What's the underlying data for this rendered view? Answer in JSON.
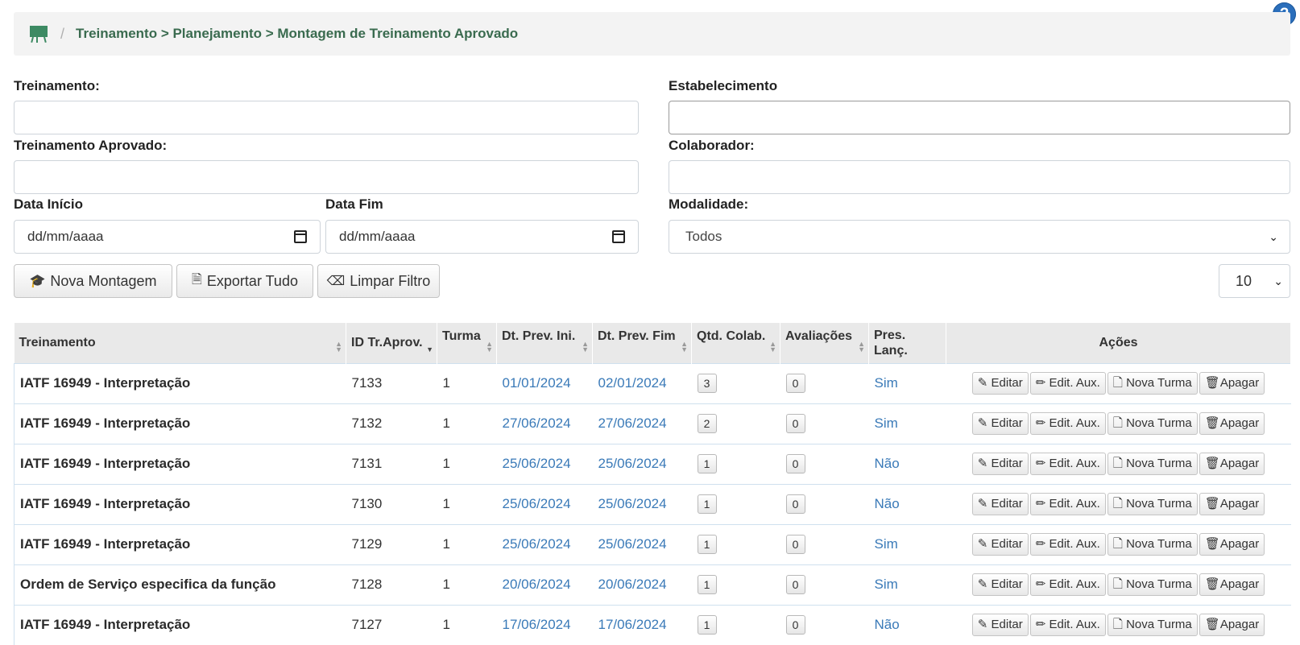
{
  "help": {
    "label": "?"
  },
  "breadcrumb": {
    "separator": "/",
    "path": "Treinamento > Planejamento > Montagem de Treinamento Aprovado"
  },
  "filters": {
    "treinamento": {
      "label": "Treinamento:",
      "value": ""
    },
    "estabelecimento": {
      "label": "Estabelecimento",
      "value": ""
    },
    "treinamento_aprovado": {
      "label": "Treinamento Aprovado:",
      "value": ""
    },
    "colaborador": {
      "label": "Colaborador:",
      "value": ""
    },
    "data_inicio": {
      "label": "Data Início",
      "placeholder": "dd/mm/aaaa"
    },
    "data_fim": {
      "label": "Data Fim",
      "placeholder": "dd/mm/aaaa"
    },
    "modalidade": {
      "label": "Modalidade:",
      "selected": "Todos"
    }
  },
  "toolbar": {
    "nova_montagem": "Nova Montagem",
    "exportar_tudo": "Exportar Tudo",
    "limpar_filtro": "Limpar Filtro",
    "page_size": "10"
  },
  "table": {
    "headers": {
      "treinamento": "Treinamento",
      "id": "ID Tr.Aprov.",
      "turma": "Turma",
      "dt_ini": "Dt. Prev. Ini.",
      "dt_fim": "Dt. Prev. Fim",
      "qtd": "Qtd. Colab.",
      "aval": "Avaliações",
      "pres_1": "Pres.",
      "pres_2": "Lanç.",
      "acoes": "Ações"
    },
    "action_labels": {
      "editar": "Editar",
      "edit_aux": "Edit. Aux.",
      "nova_turma": "Nova Turma",
      "apagar": "Apagar"
    },
    "rows": [
      {
        "treinamento": "IATF 16949 - Interpretação",
        "id": "7133",
        "turma": "1",
        "dt_ini": "01/01/2024",
        "dt_fim": "02/01/2024",
        "qtd": "3",
        "aval": "0",
        "pres": "Sim"
      },
      {
        "treinamento": "IATF 16949 - Interpretação",
        "id": "7132",
        "turma": "1",
        "dt_ini": "27/06/2024",
        "dt_fim": "27/06/2024",
        "qtd": "2",
        "aval": "0",
        "pres": "Sim"
      },
      {
        "treinamento": "IATF 16949 - Interpretação",
        "id": "7131",
        "turma": "1",
        "dt_ini": "25/06/2024",
        "dt_fim": "25/06/2024",
        "qtd": "1",
        "aval": "0",
        "pres": "Não"
      },
      {
        "treinamento": "IATF 16949 - Interpretação",
        "id": "7130",
        "turma": "1",
        "dt_ini": "25/06/2024",
        "dt_fim": "25/06/2024",
        "qtd": "1",
        "aval": "0",
        "pres": "Não"
      },
      {
        "treinamento": "IATF 16949 - Interpretação",
        "id": "7129",
        "turma": "1",
        "dt_ini": "25/06/2024",
        "dt_fim": "25/06/2024",
        "qtd": "1",
        "aval": "0",
        "pres": "Sim"
      },
      {
        "treinamento": "Ordem de Serviço especifica da função",
        "id": "7128",
        "turma": "1",
        "dt_ini": "20/06/2024",
        "dt_fim": "20/06/2024",
        "qtd": "1",
        "aval": "0",
        "pres": "Sim"
      },
      {
        "treinamento": "IATF 16949 - Interpretação",
        "id": "7127",
        "turma": "1",
        "dt_ini": "17/06/2024",
        "dt_fim": "17/06/2024",
        "qtd": "1",
        "aval": "0",
        "pres": "Não"
      }
    ]
  }
}
